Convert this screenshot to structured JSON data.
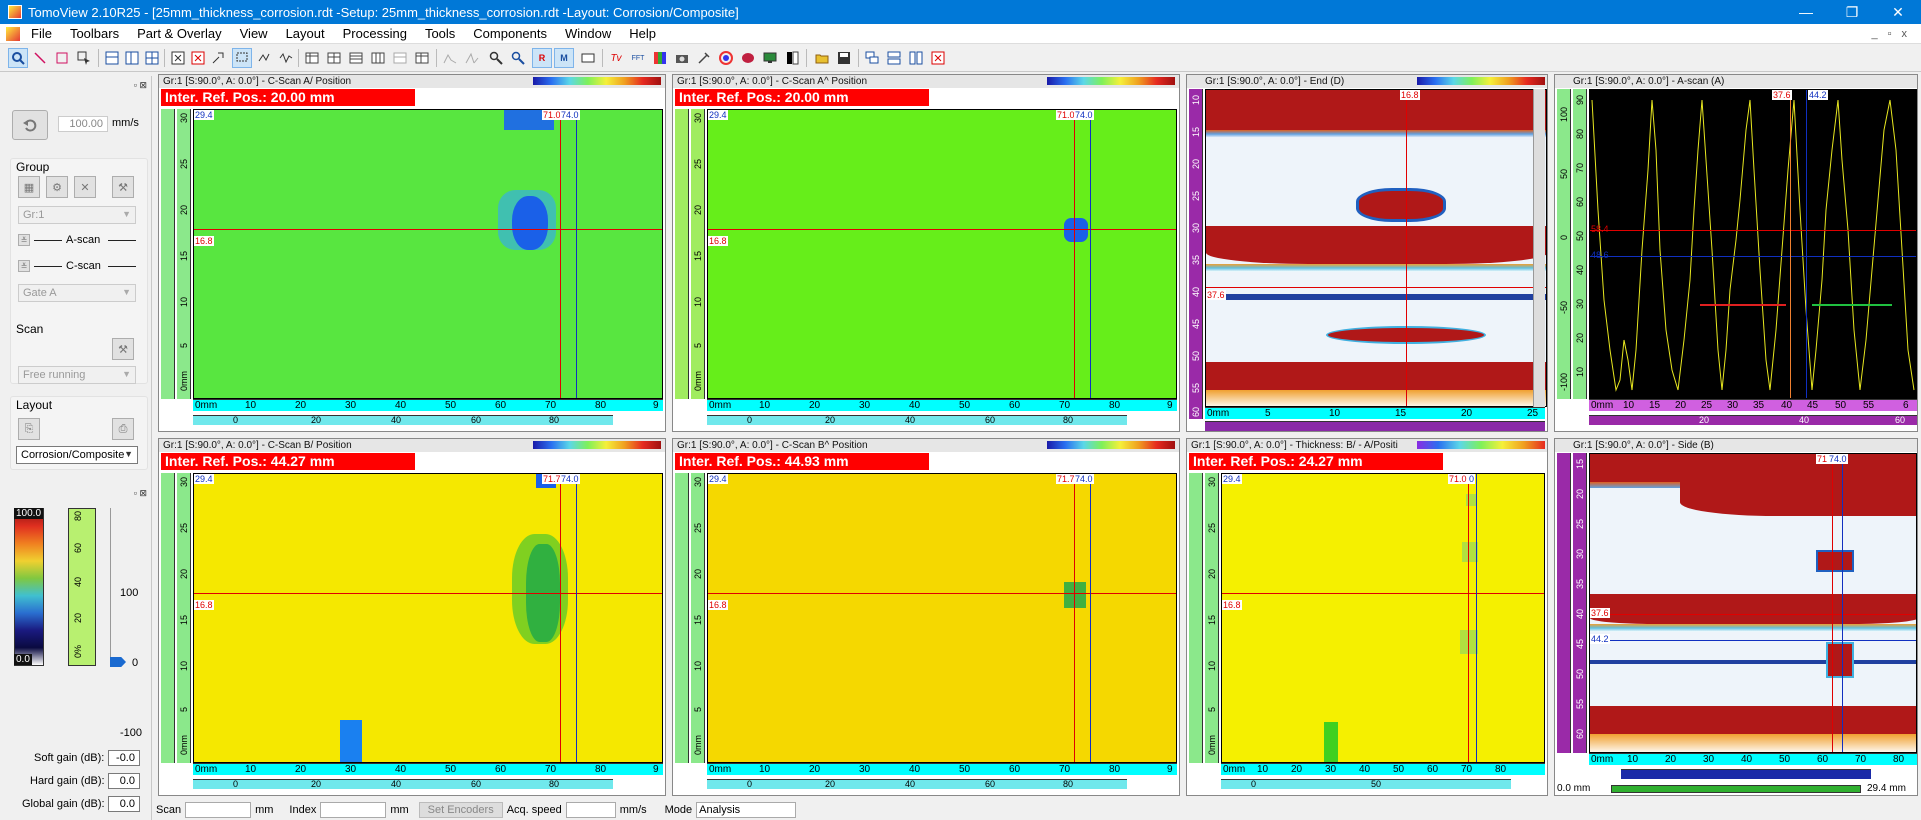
{
  "window": {
    "title": "TomoView 2.10R25 - [25mm_thickness_corrosion.rdt -Setup: 25mm_thickness_corrosion.rdt -Layout: Corrosion/Composite]",
    "min": "—",
    "max": "❐",
    "close": "✕"
  },
  "menu": [
    "File",
    "Toolbars",
    "Part & Overlay",
    "View",
    "Layout",
    "Processing",
    "Tools",
    "Components",
    "Window",
    "Help"
  ],
  "mdi_controls": [
    "_",
    "▫",
    "x"
  ],
  "left": {
    "speed_value": "100.00",
    "speed_unit": "mm/s",
    "group_label": "Group",
    "group_combo": "Gr:1",
    "ascan_label": "A-scan",
    "cscan_label": "C-scan",
    "gate_combo": "Gate A",
    "scan_label": "Scan",
    "scan_combo": "Free running",
    "layout_label": "Layout",
    "layout_combo": "Corrosion/Composite",
    "palette_top": "100.0",
    "palette_bottom": "0.0",
    "palette_ticks": [
      "0%",
      "20",
      "40",
      "60",
      "80"
    ],
    "slider_top": "100",
    "slider_mid": "0",
    "slider_bottom": "-100",
    "soft_gain_label": "Soft gain (dB):",
    "soft_gain": "-0.0",
    "hard_gain_label": "Hard gain (dB):",
    "hard_gain": "0.0",
    "global_gain_label": "Global gain (dB):",
    "global_gain": "0.0"
  },
  "panels": {
    "p1": {
      "title": "Gr:1 [S:90.0°, A: 0.0°] - C-Scan A/ Position",
      "banner": "Inter. Ref. Pos.: 20.00 mm",
      "tag_tl": "29.4",
      "tag_l": "16.8",
      "tag_t": "71.0",
      "tag_t2": "74.0"
    },
    "p2": {
      "title": "Gr:1 [S:90.0°, A: 0.0°] - C-Scan A^ Position",
      "banner": "Inter. Ref. Pos.: 20.00 mm",
      "tag_tl": "29.4",
      "tag_l": "16.8",
      "tag_t": "71.0",
      "tag_t2": "74.0"
    },
    "p3": {
      "title": "Gr:1 [S:90.0°, A: 0.0°] - End (D)",
      "tag_t": "16.8",
      "tag_l": "37.6"
    },
    "p4": {
      "title": "Gr:1 [S:90.0°, A: 0.0°] - A-scan (A)",
      "tag_t": "37.6",
      "tag_t2": "44.2",
      "tag_l": "58.4",
      "tag_l2": "48.6"
    },
    "p5": {
      "title": "Gr:1 [S:90.0°, A: 0.0°] - C-Scan B/ Position",
      "banner": "Inter. Ref. Pos.: 44.27 mm",
      "tag_tl": "29.4",
      "tag_l": "16.8",
      "tag_t": "71.7",
      "tag_t2": "74.0"
    },
    "p6": {
      "title": "Gr:1 [S:90.0°, A: 0.0°] - C-Scan B^ Position",
      "banner": "Inter. Ref. Pos.: 44.93 mm",
      "tag_tl": "29.4",
      "tag_l": "16.8",
      "tag_t": "71.7",
      "tag_t2": "74.0"
    },
    "p7": {
      "title": "Gr:1 [S:90.0°, A: 0.0°] -  Thickness: B/ - A/Positi",
      "banner": "Inter. Ref. Pos.: 24.27 mm",
      "tag_tl": "29.4",
      "tag_l": "16.8",
      "tag_t": "71.0",
      "tag_t2": "0"
    },
    "p8": {
      "title": "Gr:1 [S:90.0°, A: 0.0°] - Side (B)",
      "tag_t": "71",
      "tag_t2": "74.0",
      "tag_l": "37.6",
      "tag_l2": "44.2",
      "footer_l": "0.0 mm",
      "footer_r": "29.4 mm"
    }
  },
  "axis": {
    "c_x_ticks": [
      "0mm",
      "10",
      "20",
      "30",
      "40",
      "50",
      "60",
      "70",
      "80",
      "9"
    ],
    "c_y_ticks": [
      "0mm",
      "5",
      "10",
      "15",
      "20",
      "25",
      "30"
    ],
    "c_scroll_ticks": [
      "0",
      "20",
      "40",
      "60",
      "80"
    ],
    "end_x_ticks": [
      "0mm",
      "5",
      "10",
      "15",
      "20",
      "25"
    ],
    "end_y_ticks": [
      "10",
      "15",
      "20",
      "25",
      "30",
      "35",
      "40",
      "45",
      "50",
      "55",
      "60"
    ],
    "a_y_ticks": [
      "-100",
      "-50",
      "0",
      "50",
      "100"
    ],
    "a_y_ticks2": [
      "10",
      "20",
      "30",
      "40",
      "50",
      "60",
      "70",
      "80",
      "90"
    ],
    "a_x_ticks": [
      "0mm",
      "10",
      "15",
      "20",
      "25",
      "30",
      "35",
      "40",
      "45",
      "50",
      "55",
      "6"
    ],
    "a_scroll_ticks": [
      "20",
      "40",
      "60"
    ],
    "side_x_ticks": [
      "0mm",
      "10",
      "20",
      "30",
      "40",
      "50",
      "60",
      "70",
      "80"
    ],
    "side_y_ticks": [
      "15",
      "20",
      "25",
      "30",
      "35",
      "40",
      "45",
      "50",
      "55",
      "60"
    ],
    "thick_scroll_ticks": [
      "0",
      "50"
    ]
  },
  "status": {
    "scan": "Scan",
    "scan_unit": "mm",
    "index": "Index",
    "index_unit": "mm",
    "set_encoders": "Set Encoders",
    "acq": "Acq. speed",
    "acq_unit": "mm/s",
    "mode": "Mode",
    "mode_value": "Analysis"
  }
}
